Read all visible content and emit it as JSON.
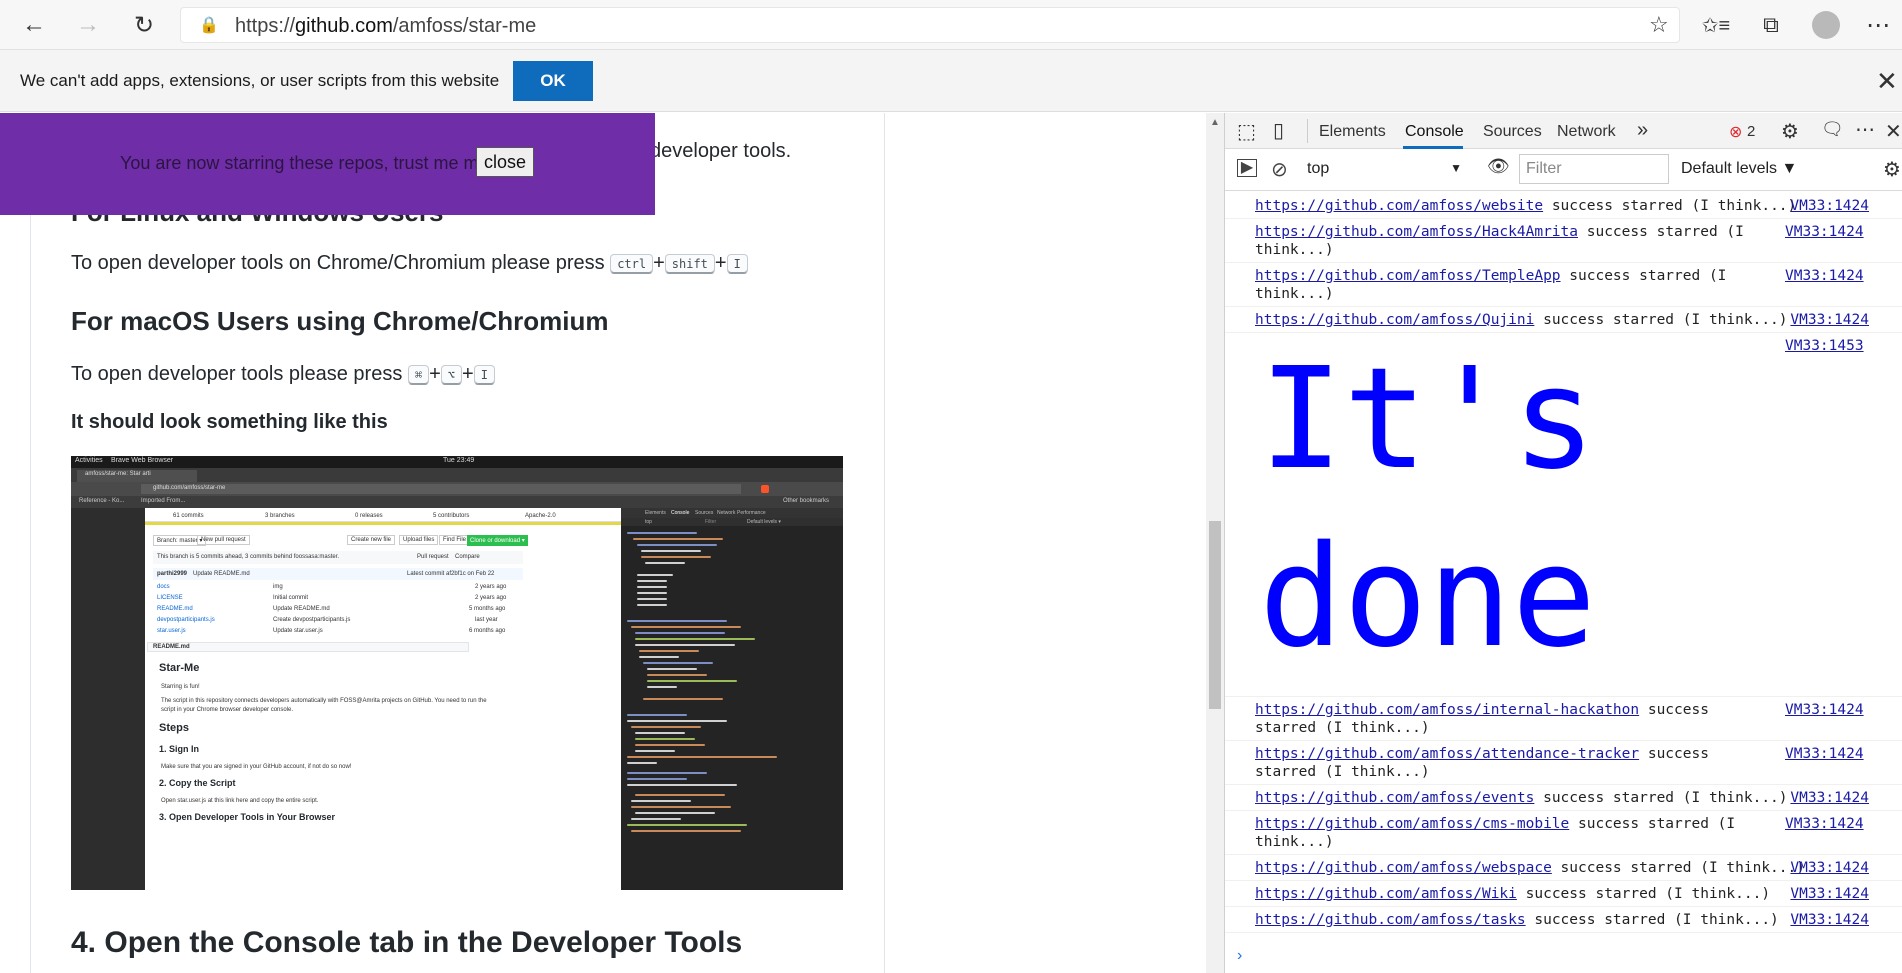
{
  "browser": {
    "url_scheme": "https://",
    "url_host": "github.com",
    "url_path": "/amfoss/star-me",
    "back_icon": "←",
    "forward_icon": "→",
    "refresh_icon": "↻",
    "lock_icon": "🔒",
    "favorite_icon": "☆",
    "favorites_icon": "✩≡",
    "collections_icon": "⧉",
    "profile_icon": "●",
    "menu_icon": "⋯"
  },
  "infobar": {
    "message": "We can't add apps, extensions, or user scripts from this website",
    "ok_label": "OK",
    "close_icon": "✕"
  },
  "banner": {
    "message": "You are now starring these repos, trust me m8",
    "close_label": "close"
  },
  "page": {
    "behind_banner_text": "developer tools.",
    "linux_heading": "For Linux and Windows Users",
    "linux_text": "To open developer tools on Chrome/Chromium please press",
    "linux_keys": [
      "ctrl",
      "shift",
      "I"
    ],
    "mac_heading": "For macOS Users using Chrome/Chromium",
    "mac_text": "To open developer tools please press",
    "mac_keys": [
      "⌘",
      "⌥",
      "I"
    ],
    "look_heading": "It should look something like this",
    "step4_heading": "4. Open the Console tab in the Developer Tools",
    "plus": "+"
  },
  "screenshot": {
    "activities": "Activities",
    "browser_name": "Brave Web Browser",
    "clock": "Tue 23:49",
    "tab_title": "amfoss/star-me: Star arti",
    "address": "github.com/amfoss/star-me",
    "bookmark_1": "Reference - Ko...",
    "bookmark_2": "Imported From...",
    "bookmark_3": "Other bookmarks",
    "stats": [
      "61 commits",
      "3 branches",
      "0 releases",
      "5 contributors",
      "Apache-2.0"
    ],
    "branch": "Branch: master ▾",
    "new_pr": "New pull request",
    "create_file": "Create new file",
    "upload_files": "Upload files",
    "find_file": "Find File",
    "clone": "Clone or download ▾",
    "ahead_behind": "This branch is 5 commits ahead, 3 commits behind foossasa:master.",
    "pull_request": "Pull request",
    "compare": "Compare",
    "latest_commit_author": "parthi2999",
    "latest_commit_msg": "Update README.md",
    "latest_commit": "Latest commit af2bf1c on Feb 22",
    "files": [
      {
        "name": "docs",
        "msg": "img",
        "when": "2 years ago"
      },
      {
        "name": "LICENSE",
        "msg": "Initial commit",
        "when": "2 years ago"
      },
      {
        "name": "README.md",
        "msg": "Update README.md",
        "when": "5 months ago"
      },
      {
        "name": "devpostparticipants.js",
        "msg": "Create devpostparticipants.js",
        "when": "last year"
      },
      {
        "name": "star.user.js",
        "msg": "Update star.user.js",
        "when": "6 months ago"
      }
    ],
    "readme_label": "README.md",
    "readme_title": "Star-Me",
    "readme_p1": "Starring is fun!",
    "readme_p2": "The script in this repository connects developers automatically with FOSS@Amrita projects on GitHub. You need to run the",
    "readme_p3": "script in your Chrome browser developer console.",
    "steps": "Steps",
    "step1": "1. Sign In",
    "step1_text": "Make sure that you are signed in your GitHub account, if not do so now!",
    "step2": "2. Copy the Script",
    "step2_text": "Open star.user.js at this link here and copy the entire script.",
    "step3": "3. Open Developer Tools in Your Browser",
    "dev_tabs": [
      "Elements",
      "Console",
      "Sources",
      "Network",
      "Performance"
    ],
    "dev_context": "top",
    "dev_filter": "Filter",
    "dev_levels": "Default levels ▾"
  },
  "devtools": {
    "inspect_icon": "⬚",
    "device_icon": "▯",
    "tabs": [
      "Elements",
      "Console",
      "Sources",
      "Network"
    ],
    "more_tabs_icon": "»",
    "error_icon": "⊗",
    "error_count": "2",
    "settings_icon": "⚙",
    "feedback_icon": "🗨",
    "menu_icon": "⋯",
    "close_icon": "✕",
    "sidebar_icon": "▶",
    "clear_icon": "⊘",
    "context": "top",
    "context_arrow": "▼",
    "eye_icon": "👁",
    "filter_placeholder": "Filter",
    "levels": "Default levels ▼",
    "settings2_icon": "⚙",
    "logs_before": [
      {
        "url": "https://github.com/amfoss/website",
        "text": " success starred (I think...)",
        "src": "VM33:1424"
      },
      {
        "url": "https://github.com/amfoss/Hack4Amrita",
        "text": " success starred (I think...)",
        "src": "VM33:1424"
      },
      {
        "url": "https://github.com/amfoss/TempleApp",
        "text": " success starred (I think...)",
        "src": "VM33:1424"
      },
      {
        "url": "https://github.com/amfoss/Qujini",
        "text": " success starred (I think...)",
        "src": "VM33:1424"
      }
    ],
    "big_src": "VM33:1453",
    "big_line1": "It's",
    "big_line2": "done",
    "logs_after": [
      {
        "url": "https://github.com/amfoss/internal-hackathon",
        "text": " success starred (I think...)",
        "src": "VM33:1424"
      },
      {
        "url": "https://github.com/amfoss/attendance-tracker",
        "text": " success starred (I think...)",
        "src": "VM33:1424"
      },
      {
        "url": "https://github.com/amfoss/events",
        "text": " success starred (I think...)",
        "src": "VM33:1424"
      },
      {
        "url": "https://github.com/amfoss/cms-mobile",
        "text": " success starred (I think...)",
        "src": "VM33:1424"
      },
      {
        "url": "https://github.com/amfoss/webspace",
        "text": " success starred (I think...)",
        "src": "VM33:1424"
      },
      {
        "url": "https://github.com/amfoss/Wiki",
        "text": " success starred (I think...)",
        "src": "VM33:1424"
      },
      {
        "url": "https://github.com/amfoss/tasks",
        "text": " success starred (I think...)",
        "src": "VM33:1424"
      }
    ],
    "prompt": "›"
  }
}
